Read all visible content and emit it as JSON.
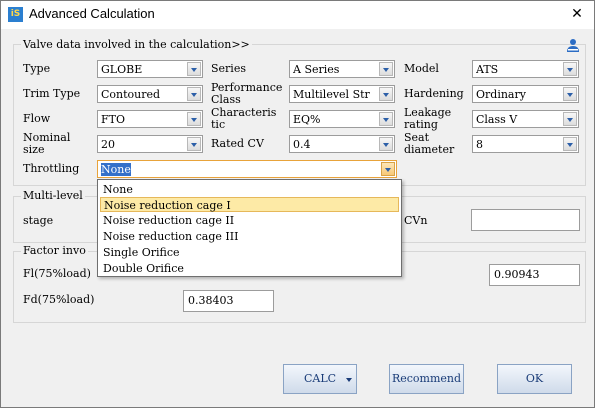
{
  "window": {
    "title": "Advanced Calculation",
    "app_icon_text": "iS",
    "close_glyph": "✕"
  },
  "valve_group": {
    "legend": "Valve data involved in the calculation>>",
    "fields": {
      "type": {
        "label": "Type",
        "value": "GLOBE"
      },
      "series": {
        "label": "Series",
        "value": "A Series"
      },
      "model": {
        "label": "Model",
        "value": "ATS"
      },
      "trim_type": {
        "label": "Trim Type",
        "value": "Contoured"
      },
      "performance_class": {
        "label1": "Performance",
        "label2": "Class",
        "value": "Multilevel Str"
      },
      "hardening": {
        "label": "Hardening",
        "value": "Ordinary"
      },
      "flow": {
        "label": "Flow",
        "value": "FTO"
      },
      "characteristic": {
        "label1": "Characteris",
        "label2": "tic",
        "value": "EQ%"
      },
      "leakage_rating": {
        "label1": "Leakage",
        "label2": "rating",
        "value": "Class V"
      },
      "nominal_size": {
        "label1": "Nominal",
        "label2": "size",
        "value": "20"
      },
      "rated_cv": {
        "label": "Rated CV",
        "value": "0.4"
      },
      "seat_diameter": {
        "label1": "Seat",
        "label2": "diameter",
        "value": "8"
      },
      "throttling": {
        "label": "Throttling",
        "value": "None"
      }
    }
  },
  "throttling_options": [
    "None",
    "Noise reduction cage I",
    "Noise reduction cage II",
    "Noise reduction cage III",
    "Single Orifice",
    "Double Orifice"
  ],
  "multi_level": {
    "legend": "Multi-level",
    "stage_label": "stage",
    "cvn_label": "CVn",
    "cvn_value": ""
  },
  "factor_group": {
    "legend": "Factor  invo",
    "fl_label": "Fl(75%load)",
    "fd_label": "Fd(75%load)",
    "fd_value": "0.38403",
    "right_value": "0.90943"
  },
  "buttons": {
    "calc": "CALC",
    "recommend": "Recommend",
    "ok": "OK"
  },
  "icons": {
    "user": "user-icon",
    "dropdown_arrow": "chevron-down-icon"
  },
  "colors": {
    "selection": "#3470c9",
    "highlight": "#fdeaa6",
    "button_text": "#1a3c78"
  }
}
